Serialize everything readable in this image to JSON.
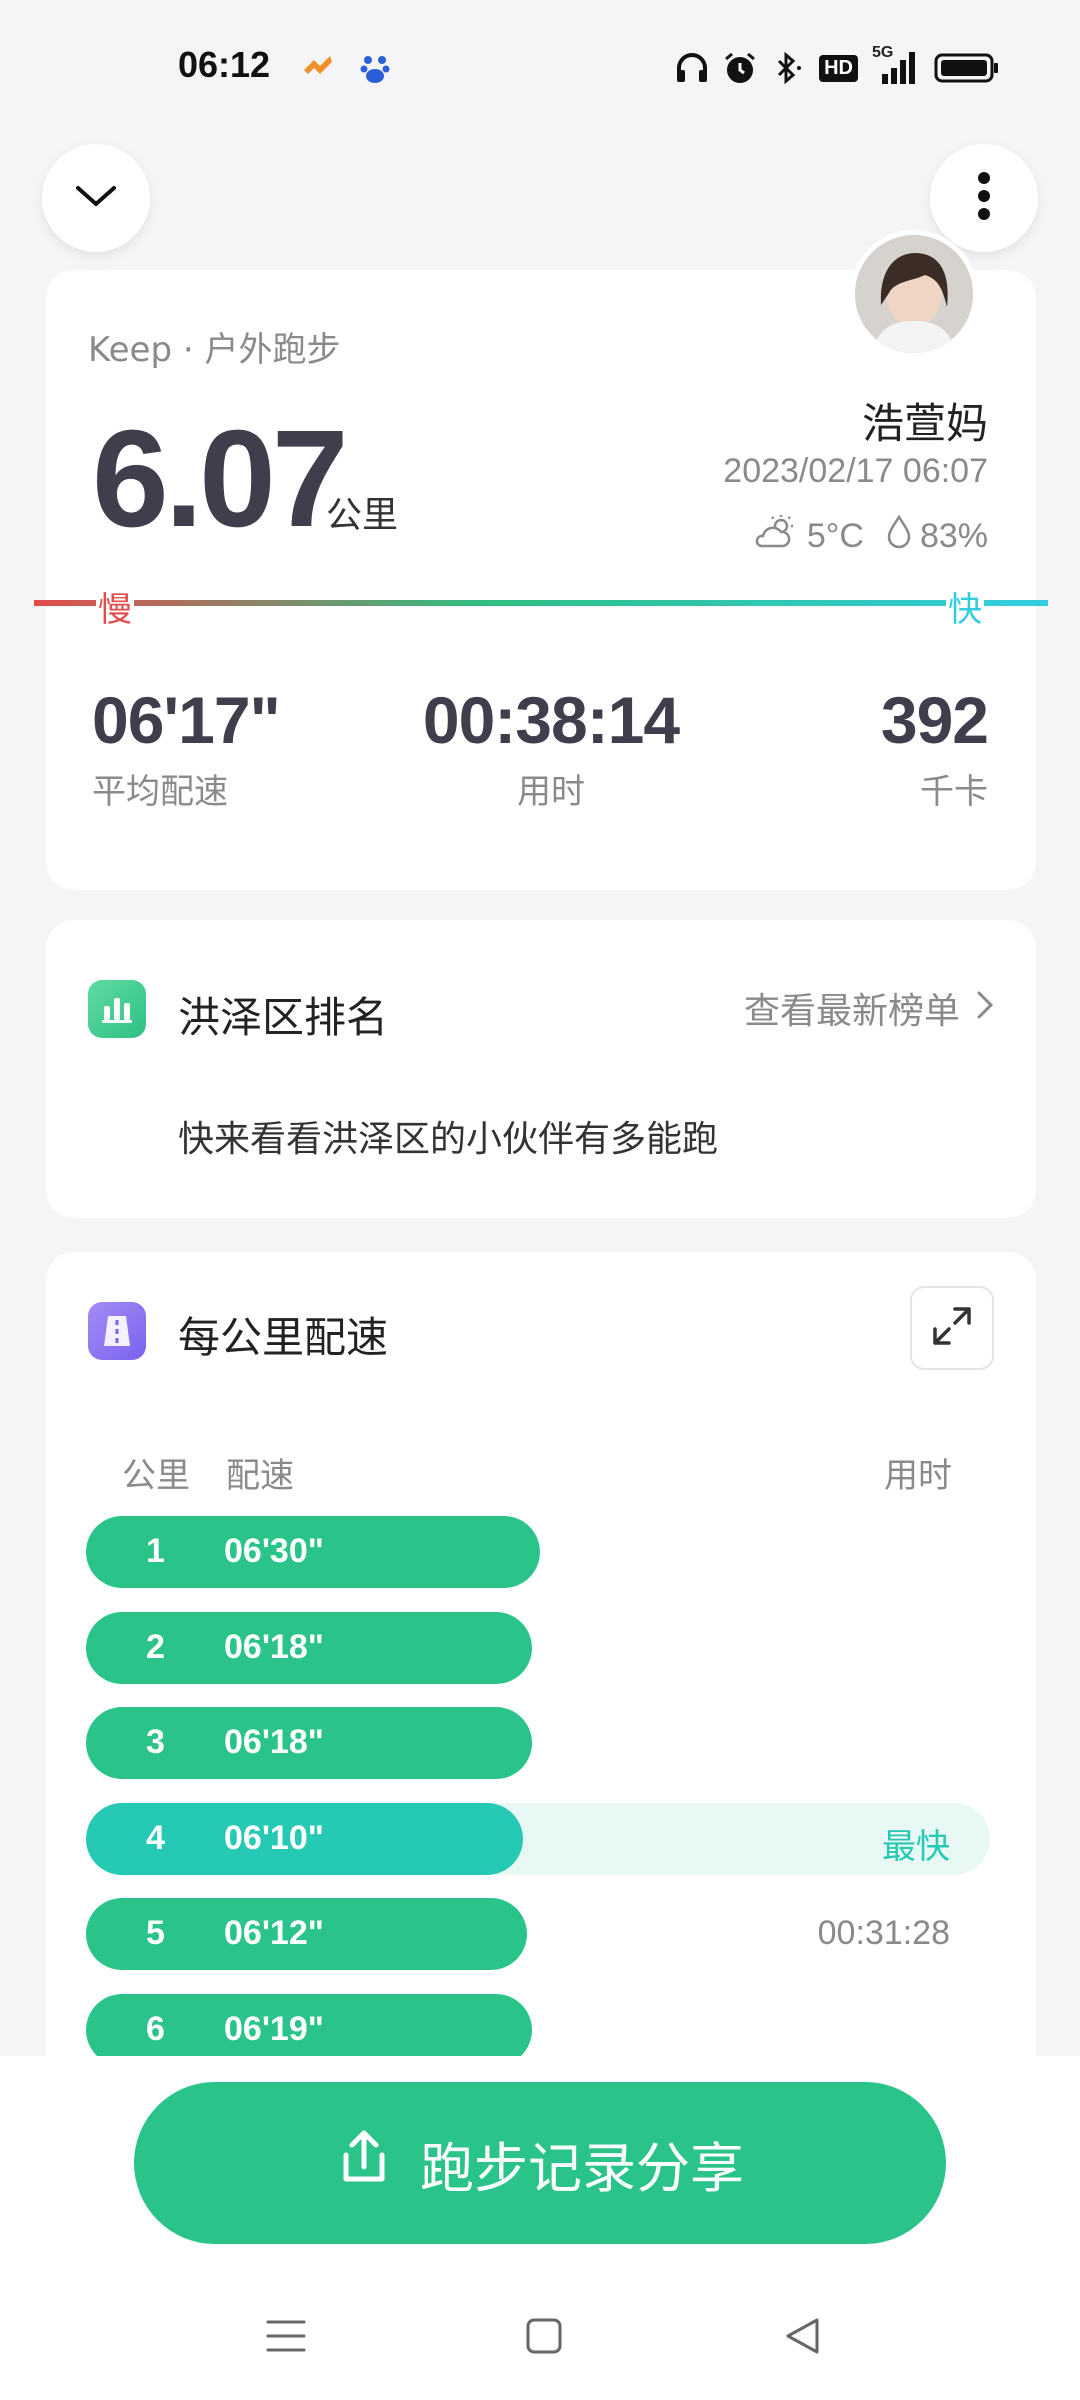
{
  "status_bar": {
    "time": "06:12",
    "left_icons": [
      "strava-icon",
      "baidu-icon"
    ],
    "right_icons": [
      "headphones-icon",
      "alarm-icon",
      "bluetooth-icon",
      "hd-badge",
      "signal-5g-icon",
      "battery-icon"
    ],
    "hd_label": "HD",
    "network_label": "5G"
  },
  "header": {
    "collapse_icon": "chevron-down-icon",
    "more_icon": "more-vertical-icon"
  },
  "summary": {
    "source": "Keep · 户外跑步",
    "distance": "6.07",
    "distance_unit": "公里",
    "username": "浩萱妈",
    "datetime": "2023/02/17 06:07",
    "temperature": "5°C",
    "humidity": "83%",
    "speed_slow": "慢",
    "speed_fast": "快",
    "stats": [
      {
        "value": "06'17\"",
        "label": "平均配速"
      },
      {
        "value": "00:38:14",
        "label": "用时"
      },
      {
        "value": "392",
        "label": "千卡"
      }
    ]
  },
  "ranking": {
    "title": "洪泽区排名",
    "link": "查看最新榜单",
    "description": "快来看看洪泽区的小伙伴有多能跑"
  },
  "pace": {
    "title": "每公里配速",
    "col_km": "公里",
    "col_pace": "配速",
    "col_time": "用时",
    "max_bar_pct": 100,
    "rows": [
      {
        "km": "1",
        "pace": "06'30\"",
        "bar_pct": 50.2,
        "right": "",
        "fastest": false
      },
      {
        "km": "2",
        "pace": "06'18\"",
        "bar_pct": 49.3,
        "right": "",
        "fastest": false
      },
      {
        "km": "3",
        "pace": "06'18\"",
        "bar_pct": 49.3,
        "right": "",
        "fastest": false
      },
      {
        "km": "4",
        "pace": "06'10\"",
        "bar_pct": 48.3,
        "right": "最快",
        "fastest": true
      },
      {
        "km": "5",
        "pace": "06'12\"",
        "bar_pct": 48.8,
        "right": "00:31:28",
        "fastest": false
      },
      {
        "km": "6",
        "pace": "06'19\"",
        "bar_pct": 49.3,
        "right": "",
        "fastest": false
      }
    ]
  },
  "share": {
    "label": "跑步记录分享"
  },
  "nav": {
    "icons": [
      "menu-icon",
      "home-square-icon",
      "back-triangle-icon"
    ]
  }
}
